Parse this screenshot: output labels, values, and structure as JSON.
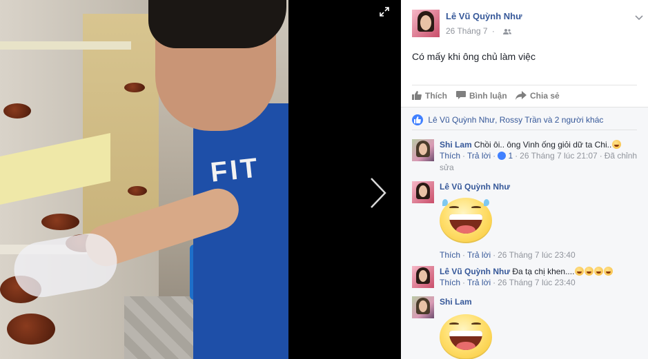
{
  "post": {
    "author": "Lê Vũ Quỳnh Như",
    "date": "26 Tháng 7",
    "audience_icon": "friends-icon",
    "text": "Có mấy khi ông chủ làm việc"
  },
  "photo": {
    "shirt_text": "FIT"
  },
  "actions": {
    "like": "Thích",
    "comment": "Bình luận",
    "share": "Chia sẻ"
  },
  "reactions": {
    "summary": "Lê Vũ Quỳnh Như, Rossy Trần và 2 người khác"
  },
  "comments": [
    {
      "author": "Shi Lam",
      "text": "Chồi ôi.. ông Vinh ống giỏi dữ ta Chi..",
      "like": "Thích",
      "reply": "Trả lời",
      "like_count": "1",
      "time": "26 Tháng 7 lúc 21:07",
      "edited": "Đã chỉnh sửa"
    },
    {
      "author": "Lê Vũ Quỳnh Như",
      "sticker": "laughing-sticker",
      "like": "Thích",
      "reply": "Trả lời",
      "time": "26 Tháng 7 lúc 23:40"
    },
    {
      "author": "Lê Vũ Quỳnh Như",
      "text": "Đa tạ chị khen....",
      "like": "Thích",
      "reply": "Trả lời",
      "time": "26 Tháng 7 lúc 23:40"
    },
    {
      "author": "Shi Lam",
      "sticker": "tongue-out-sticker"
    }
  ],
  "colors": {
    "link": "#365899",
    "meta": "#90949c",
    "like_blue": "#4080ff",
    "comment_bg": "#f6f7f9"
  }
}
